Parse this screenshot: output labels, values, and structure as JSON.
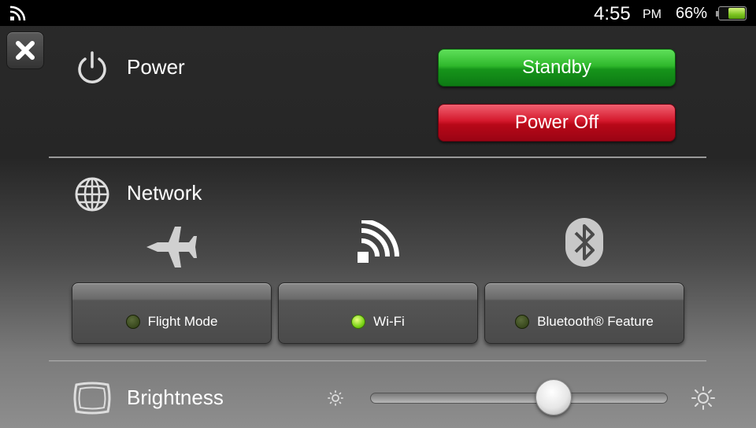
{
  "status_bar": {
    "time": "4:55",
    "ampm": "PM",
    "battery_percent_text": "66%",
    "battery_level": 0.66
  },
  "power": {
    "title": "Power",
    "standby_label": "Standby",
    "power_off_label": "Power Off"
  },
  "network": {
    "title": "Network",
    "toggles": [
      {
        "label": "Flight Mode",
        "icon": "airplane-icon",
        "on": false
      },
      {
        "label": "Wi-Fi",
        "icon": "wifi-icon",
        "on": true
      },
      {
        "label": "Bluetooth® Feature",
        "icon": "bluetooth-icon",
        "on": false
      }
    ]
  },
  "brightness": {
    "title": "Brightness",
    "level": 0.62
  },
  "colors": {
    "standby_green": "#16941a",
    "power_off_red": "#c41020",
    "led_on": "#7cd418",
    "led_off": "#2a3a10"
  }
}
